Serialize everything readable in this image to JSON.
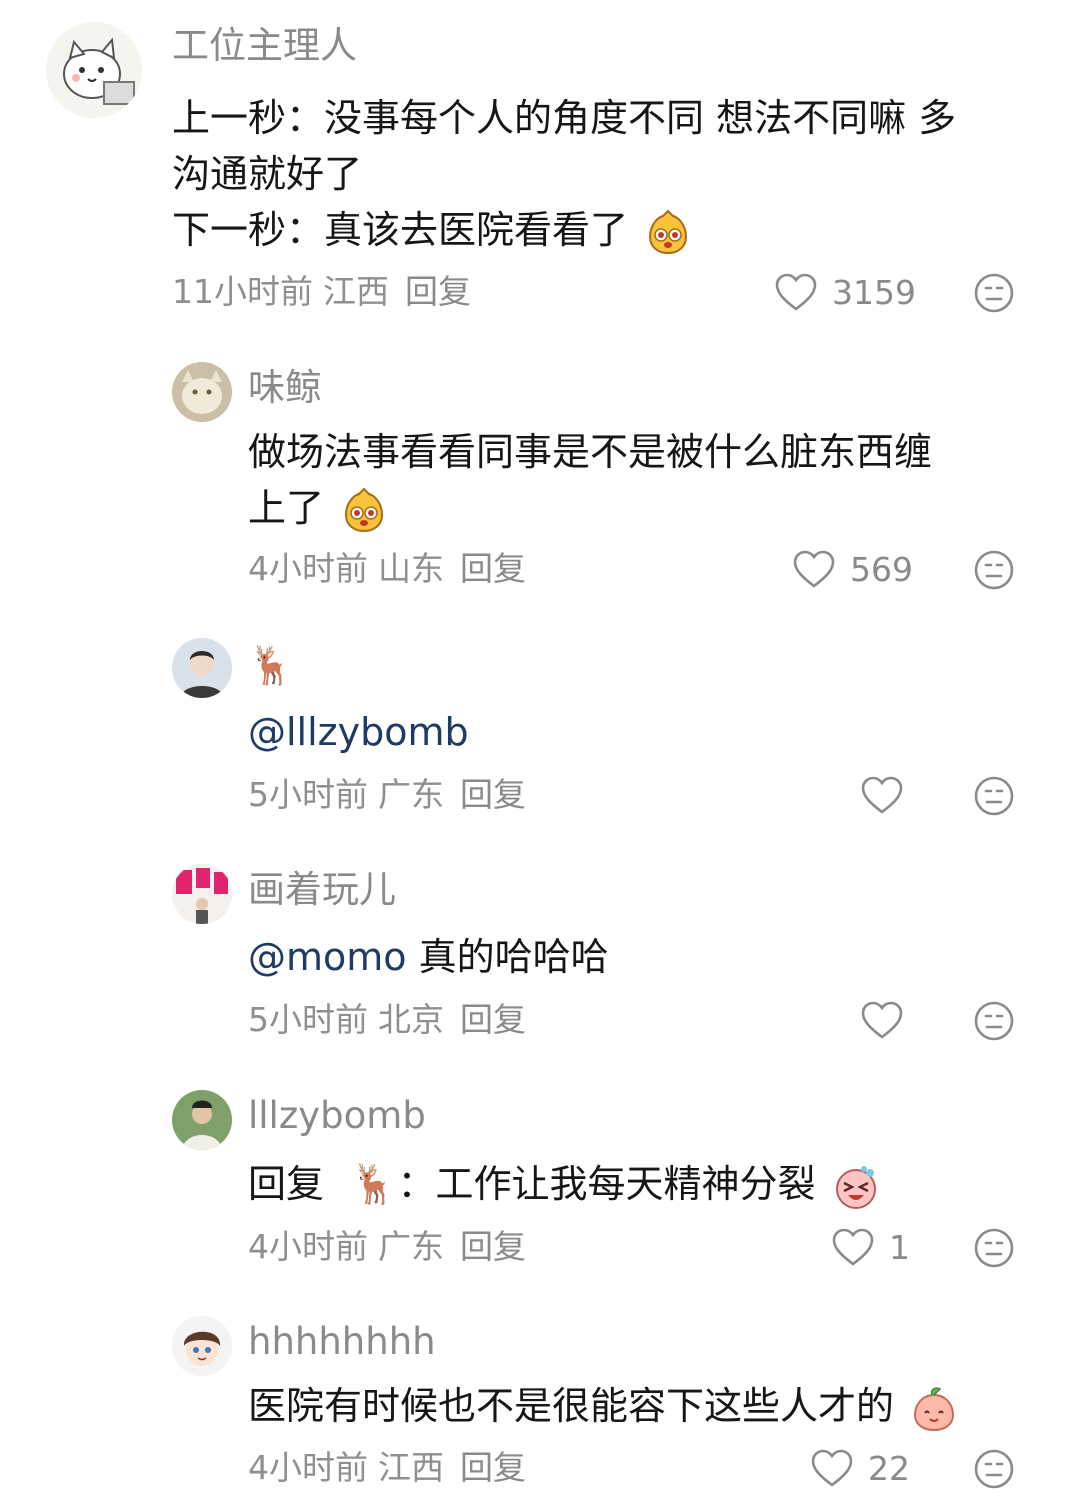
{
  "comments": [
    {
      "username": "工位主理人",
      "lines": [
        "上一秒：没事每个人的角度不同 想法不同嘛 多",
        "沟通就好了",
        "下一秒：真该去医院看看了"
      ],
      "emoji": "happy-sticker-icon",
      "time": "11小时前",
      "region": "江西",
      "reply": "回复",
      "likes": "3159"
    },
    {
      "username": "味鲸",
      "lines": [
        "做场法事看看同事是不是被什么脏东西缠",
        "上了"
      ],
      "emoji": "happy-sticker-icon",
      "time": "4小时前",
      "region": "山东",
      "reply": "回复",
      "likes": "569"
    },
    {
      "username": "🦌",
      "mention": "@lllzybomb",
      "time": "5小时前",
      "region": "广东",
      "reply": "回复",
      "likes": ""
    },
    {
      "username": "画着玩儿",
      "mention": "@momo",
      "text": " 真的哈哈哈",
      "time": "5小时前",
      "region": "北京",
      "reply": "回复",
      "likes": ""
    },
    {
      "username": "lllzybomb",
      "reply_prefix": "回复",
      "reply_to": "🦌",
      "text": "：工作让我每天精神分裂",
      "emoji": "laughing-sticker-icon",
      "time": "4小时前",
      "region": "广东",
      "reply": "回复",
      "likes": "1"
    },
    {
      "username": "hhhhhhhh",
      "text": "医院有时候也不是很能容下这些人才的",
      "emoji": "peach-smile-sticker-icon",
      "time": "4小时前",
      "region": "江西",
      "reply": "回复",
      "likes": "22"
    }
  ],
  "colors": {
    "username": "#8a8a8a",
    "text": "#161616",
    "mention": "#1e3a66",
    "meta": "#8f8f8f"
  }
}
